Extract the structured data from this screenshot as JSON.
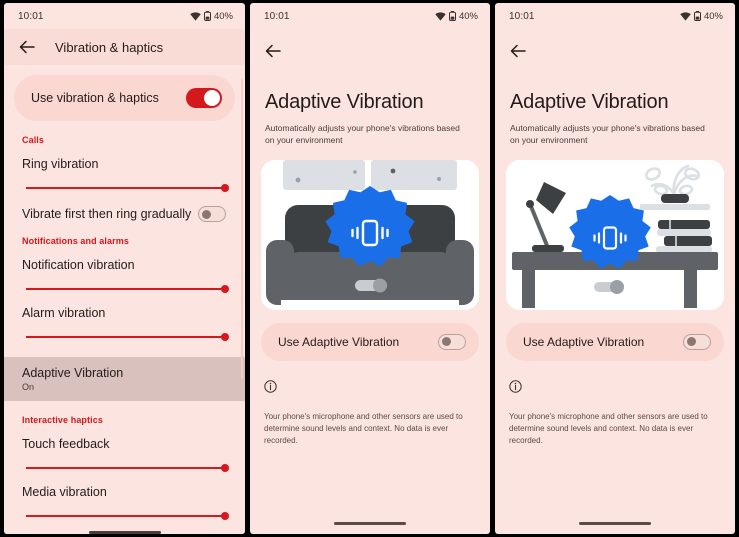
{
  "theme": {
    "page_bg": "#fce4e0",
    "accent_red": "#d4191d",
    "card_pink": "#fad7d1",
    "badge_blue": "#1a6fe8",
    "highlight_row": "#d9c2bd",
    "text_dark": "#241b19"
  },
  "status_bar": {
    "time": "10:01",
    "battery_percent": "40%",
    "wifi_icon": "wifi-icon",
    "battery_icon": "battery-icon"
  },
  "panel1": {
    "back_icon": "back-arrow-icon",
    "title": "Vibration & haptics",
    "master_toggle": {
      "label": "Use vibration & haptics",
      "state": "on"
    },
    "sections": [
      {
        "header": "Calls",
        "items": [
          {
            "type": "slider",
            "label": "Ring vibration",
            "value": 100
          },
          {
            "type": "toggle",
            "label": "Vibrate first then ring gradually",
            "state": "off"
          }
        ]
      },
      {
        "header": "Notifications and alarms",
        "items": [
          {
            "type": "slider",
            "label": "Notification vibration",
            "value": 100
          },
          {
            "type": "slider",
            "label": "Alarm vibration",
            "value": 100
          }
        ]
      },
      {
        "header": "Interactive haptics",
        "items": [
          {
            "type": "slider",
            "label": "Touch feedback",
            "value": 100
          },
          {
            "type": "slider",
            "label": "Media vibration",
            "value": 100
          }
        ]
      }
    ],
    "highlighted_row": {
      "title": "Adaptive Vibration",
      "subtitle": "On"
    }
  },
  "panel2": {
    "back_icon": "back-arrow-icon",
    "title": "Adaptive Vibration",
    "subtitle": "Automatically adjusts your phone's vibrations based on your environment",
    "illustration": "couch-scene-illustration",
    "badge_icon": "vibrating-phone-icon",
    "use_toggle": {
      "label": "Use Adaptive Vibration",
      "state": "off"
    },
    "info_icon": "info-icon",
    "info_text": "Your phone's microphone and other sensors are used to determine sound levels and context. No data is ever recorded."
  },
  "panel3": {
    "back_icon": "back-arrow-icon",
    "title": "Adaptive Vibration",
    "subtitle": "Automatically adjusts your phone's vibrations based on your environment",
    "illustration": "desk-scene-illustration",
    "badge_icon": "vibrating-phone-icon",
    "use_toggle": {
      "label": "Use Adaptive Vibration",
      "state": "off"
    },
    "info_icon": "info-icon",
    "info_text": "Your phone's microphone and other sensors are used to determine sound levels and context. No data is ever recorded."
  }
}
